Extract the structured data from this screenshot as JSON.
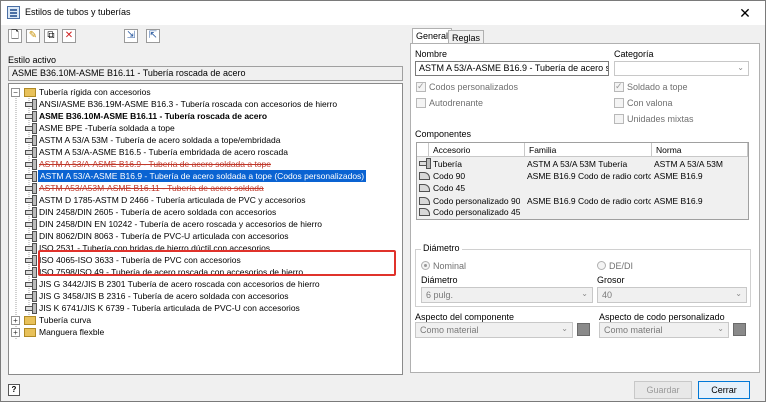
{
  "window": {
    "title": "Estilos de tubos y tuberías"
  },
  "toolbar": {
    "buttons": [
      {
        "name": "new-style-button",
        "glyph": "🗋"
      },
      {
        "name": "edit-style-button",
        "glyph": "✎"
      },
      {
        "name": "copy-style-button",
        "glyph": "⧉"
      },
      {
        "name": "delete-style-button",
        "glyph": "✕"
      },
      {
        "name": "import-style-button",
        "glyph": "⇲"
      },
      {
        "name": "export-style-button",
        "glyph": "⇱"
      }
    ]
  },
  "active_style": {
    "label": "Estilo activo",
    "value": "ASME B36.10M-ASME B16.11 - Tubería roscada de acero"
  },
  "tree": {
    "groups": [
      {
        "label": "Tubería rígida con accesorios"
      },
      {
        "label": "Tubería curva"
      },
      {
        "label": "Manguera flexble"
      }
    ],
    "items": [
      {
        "text": "ANSI/ASME B36.19M-ASME B16.3 - Tubería roscada con accesorios de hierro",
        "style": "normal"
      },
      {
        "text": "ASME B36.10M-ASME B16.11 - Tubería roscada de acero",
        "style": "bold"
      },
      {
        "text": "ASME BPE -Tubería soldada a tope",
        "style": "normal"
      },
      {
        "text": "ASTM A 53/A 53M - Tubería de acero soldada a tope/embridada",
        "style": "normal"
      },
      {
        "text": "ASTM A 53/A-ASME B16.5 - Tubería embridada de acero roscada",
        "style": "normal"
      },
      {
        "text": "ASTM A 53/A-ASME B16.9 - Tubería de acero soldada a tope",
        "style": "strike"
      },
      {
        "text": "ASTM A 53/A-ASME B16.9 - Tubería de acero soldada a tope (Codos personalizados)",
        "style": "selected"
      },
      {
        "text": "ASTM A53/A53M-ASME B16.11 - Tubería de acero soldada",
        "style": "strike"
      },
      {
        "text": "ASTM D 1785-ASTM D 2466 - Tubería articulada de PVC y accesorios",
        "style": "normal"
      },
      {
        "text": "DIN 2458/DIN 2605 - Tubería de acero soldada con accesorios",
        "style": "normal"
      },
      {
        "text": "DIN 2458/DIN EN 10242 - Tubería de acero roscada y accesorios de hierro",
        "style": "normal"
      },
      {
        "text": "DIN 8062/DIN 8063 - Tubería de PVC-U articulada con accesorios",
        "style": "normal"
      },
      {
        "text": "ISO 2531 - Tubería con bridas de hierro dúctil con accesorios",
        "style": "normal"
      },
      {
        "text": "ISO 4065-ISO 3633 - Tubería de PVC con accesorios",
        "style": "normal"
      },
      {
        "text": "ISO 7598/ISO 49 - Tubería de acero roscada con accesorios de hierro",
        "style": "normal"
      },
      {
        "text": "JIS G 3442/JIS B 2301 Tubería de acero roscada con accesorios de hierro",
        "style": "normal"
      },
      {
        "text": "JIS G 3458/JIS B 2316 - Tubería de acero soldada con accesorios",
        "style": "normal"
      },
      {
        "text": "JIS K 6741/JIS K 6739 - Tubería articulada de PVC-U con accesorios",
        "style": "normal"
      }
    ]
  },
  "tabs": [
    {
      "label": "General"
    },
    {
      "label": "Reglas"
    }
  ],
  "general": {
    "name_label": "Nombre",
    "name_value": "ASTM A 53/A-ASME B16.9 - Tubería de acero so",
    "category_label": "Categoría",
    "category_value": "",
    "checks": [
      {
        "label": "Codos personalizados",
        "checked": true
      },
      {
        "label": "Autodrenante",
        "checked": false
      },
      {
        "label": "Soldado a tope",
        "checked": true
      },
      {
        "label": "Con valona",
        "checked": false
      },
      {
        "label": "Unidades mixtas",
        "checked": false
      }
    ],
    "components_label": "Componentes",
    "components_headers": [
      "Accesorio",
      "Familia",
      "Norma"
    ],
    "components_rows": [
      {
        "accessory": "Tubería",
        "family": "ASTM A 53/A 53M Tubería",
        "standard": "ASTM A 53/A 53M"
      },
      {
        "accessory": "Codo 90",
        "family": "ASME B16.9 Codo de radio corto",
        "standard": "ASME B16.9"
      },
      {
        "accessory": "Codo 45",
        "family": "",
        "standard": ""
      },
      {
        "accessory": "Codo personalizado 90",
        "family": "ASME B16.9 Codo de radio corto",
        "standard": "ASME B16.9"
      },
      {
        "accessory": "Codo personalizado 45",
        "family": "",
        "standard": ""
      }
    ],
    "diameter": {
      "group_label": "Diámetro",
      "nominal_label": "Nominal",
      "de_di_label": "DE/DI",
      "diameter_label": "Diámetro",
      "diameter_value": "6 pulg.",
      "thickness_label": "Grosor",
      "thickness_value": "40"
    },
    "component_appearance_label": "Aspecto del componente",
    "component_appearance_value": "Como material",
    "custom_elbow_appearance_label": "Aspecto de codo personalizado",
    "custom_elbow_appearance_value": "Como material"
  },
  "footer": {
    "save_label": "Guardar",
    "close_label": "Cerrar",
    "help_glyph": "?"
  },
  "colors": {
    "selection": "#0a63d2",
    "highlight_box": "#e0322b",
    "strike": "#c0392b"
  }
}
